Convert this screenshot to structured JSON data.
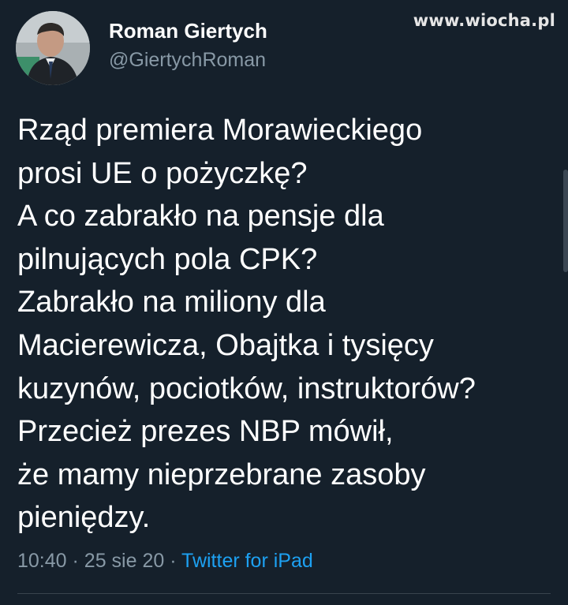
{
  "watermark": "www.wiocha.pl",
  "author": {
    "display_name": "Roman Giertych",
    "handle": "@GiertychRoman",
    "avatar_icon": "profile-photo"
  },
  "tweet": {
    "lines": [
      "Rząd premiera Morawieckiego",
      "prosi UE o pożyczkę?",
      "A co zabrakło na pensje dla",
      "pilnujących pola CPK?",
      "Zabrakło na miliony dla",
      "Macierewicza, Obajtka i tysięcy",
      "kuzynów, pociotków, instruktorów?",
      "Przecież prezes NBP mówił,",
      "że mamy nieprzebrane zasoby",
      "pieniędzy."
    ]
  },
  "meta": {
    "time": "10:40",
    "separator": "·",
    "date": "25 sie 20",
    "source": "Twitter for iPad"
  },
  "colors": {
    "background": "#15202b",
    "text": "#ffffff",
    "secondary": "#8899a6",
    "link": "#1da1f2"
  }
}
